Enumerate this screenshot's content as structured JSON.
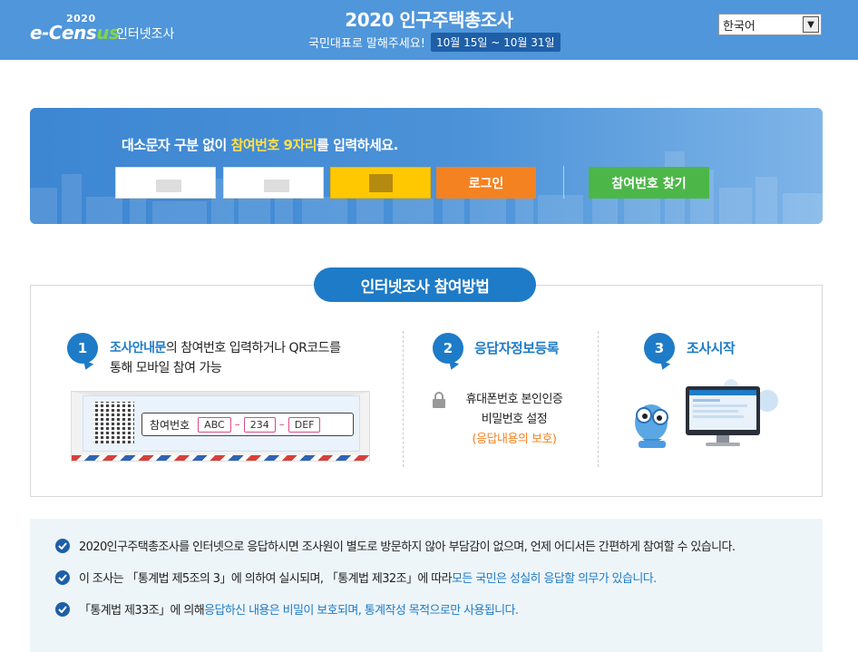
{
  "header": {
    "logo_year": "2020",
    "logo_main_a": "e-Cens",
    "logo_main_b": "us",
    "logo_sub": "인터넷조사",
    "title": "2020 인구주택총조사",
    "slogan": "국민대표로 말해주세요!",
    "date_badge": "10월 15일 ~ 10월 31일",
    "language": {
      "selected": "한국어",
      "arrow": "▼"
    }
  },
  "login": {
    "instruction_pre": "대소문자 구분 없이 ",
    "instruction_highlight": "참여번호 9자리",
    "instruction_post": "를 입력하세요.",
    "login_label": "로그인",
    "find_label": "참여번호 찾기"
  },
  "method": {
    "title": "인터넷조사 참여방법",
    "steps": [
      {
        "number": "1",
        "line1_highlight": "조사안내문",
        "line1_rest": "의 참여번호 입력하거나 QR코드를",
        "line2": "통해 모바일 참여 가능",
        "code_label": "참여번호",
        "code_parts": [
          "ABC",
          "234",
          "DEF"
        ],
        "code_sep": "–"
      },
      {
        "number": "2",
        "title": "응답자정보등록",
        "line1": "휴대폰번호 본인인증",
        "line2": "비밀번호 설정",
        "line3": "(응답내용의 보호)"
      },
      {
        "number": "3",
        "title": "조사시작"
      }
    ]
  },
  "notices": [
    {
      "text": "2020인구주택총조사를 인터넷으로 응답하시면 조사원이 별도로 방문하지 않아 부담감이 없으며, 언제 어디서든 간편하게 참여할 수 있습니다."
    },
    {
      "pre": "이 조사는 「통계법 제5조의 3」에 의하여 실시되며, 「통계법 제32조」에 따라 ",
      "highlight": "모든 국민은 성실히 응답할 의무가 있습니다."
    },
    {
      "pre": "「통계법 제33조」에 의해 ",
      "highlight": "응답하신 내용은 비밀이 보호되며, 통계작성 목적으로만 사용됩니다."
    }
  ],
  "colors": {
    "header_bg": "#4f96da",
    "primary": "#1e7bc7",
    "login_btn": "#f58220",
    "find_btn": "#4cb748",
    "highlight_yellow": "#ffe04a",
    "warning_orange": "#f58220"
  }
}
